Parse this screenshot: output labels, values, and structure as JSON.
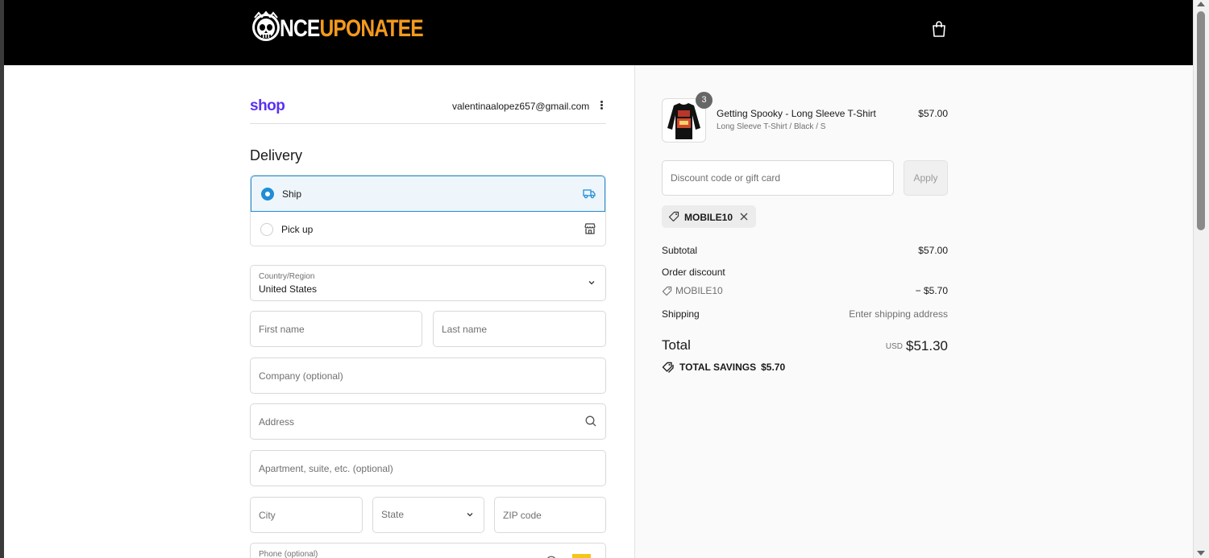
{
  "header": {
    "logo_prefix": "NCE",
    "logo_suffix": "UPONATEE",
    "brand_colors": {
      "white": "#ffffff",
      "orange": "#f39a1d"
    },
    "cart_icon": "shopping-bag-icon"
  },
  "account": {
    "shop_label": "shop",
    "email": "valentinaalopez657@gmail.com",
    "menu_icon": "kebab-menu-icon"
  },
  "delivery": {
    "heading": "Delivery",
    "options": [
      {
        "label": "Ship",
        "selected": true,
        "icon": "truck-icon"
      },
      {
        "label": "Pick up",
        "selected": false,
        "icon": "store-icon"
      }
    ],
    "accent_color": "#1f8dd6"
  },
  "form": {
    "country_label": "Country/Region",
    "country_value": "United States",
    "first_name_placeholder": "First name",
    "last_name_placeholder": "Last name",
    "company_placeholder": "Company (optional)",
    "address_placeholder": "Address",
    "apartment_placeholder": "Apartment, suite, etc. (optional)",
    "city_placeholder": "City",
    "state_label": "State",
    "zip_placeholder": "ZIP code",
    "phone_label": "Phone (optional)"
  },
  "order": {
    "item": {
      "quantity": "3",
      "name": "Getting Spooky - Long Sleeve T-Shirt",
      "variant": "Long Sleeve T-Shirt / Black / S",
      "price": "$57.00"
    },
    "discount_placeholder": "Discount code or gift card",
    "apply_label": "Apply",
    "applied_code": "MOBILE10",
    "subtotal_label": "Subtotal",
    "subtotal_value": "$57.00",
    "order_discount_label": "Order discount",
    "discount_code": "MOBILE10",
    "discount_value": "− $5.70",
    "shipping_label": "Shipping",
    "shipping_value": "Enter shipping address",
    "total_label": "Total",
    "currency": "USD",
    "total_value": "$51.30",
    "savings_label": "TOTAL SAVINGS",
    "savings_value": "$5.70"
  }
}
